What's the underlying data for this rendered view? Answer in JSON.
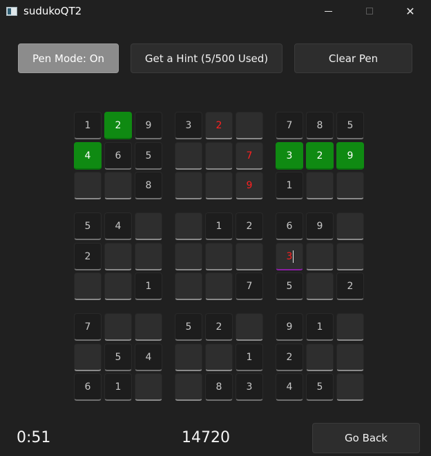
{
  "window": {
    "title": "sudukoQT2",
    "minimize_icon": "minimize-icon",
    "maximize_icon": "maximize-icon",
    "close_icon": "close-icon"
  },
  "toolbar": {
    "pen_mode_label": "Pen Mode: On",
    "hint_label": "Get a Hint (5/500 Used)",
    "clear_pen_label": "Clear Pen"
  },
  "board": {
    "rows": [
      [
        "1",
        "2",
        "9",
        "3",
        "2",
        "",
        "7",
        "8",
        "5"
      ],
      [
        "4",
        "6",
        "5",
        "",
        "",
        "7",
        "3",
        "2",
        "9"
      ],
      [
        "",
        "",
        "8",
        "",
        "",
        "9",
        "1",
        "",
        ""
      ],
      [
        "5",
        "4",
        "",
        "",
        "1",
        "2",
        "6",
        "9",
        ""
      ],
      [
        "2",
        "",
        "",
        "",
        "",
        "",
        "3",
        "",
        ""
      ],
      [
        "",
        "",
        "1",
        "",
        "",
        "7",
        "5",
        "",
        "2"
      ],
      [
        "7",
        "",
        "",
        "5",
        "2",
        "",
        "9",
        "1",
        ""
      ],
      [
        "",
        "5",
        "4",
        "",
        "",
        "1",
        "2",
        "",
        ""
      ],
      [
        "6",
        "1",
        "",
        "",
        "8",
        "3",
        "4",
        "5",
        ""
      ]
    ],
    "cell_styles": [
      [
        "given",
        "green",
        "given",
        "given",
        "red",
        "empty",
        "given",
        "given",
        "given"
      ],
      [
        "green",
        "given",
        "given",
        "empty",
        "empty",
        "red",
        "green",
        "green",
        "green"
      ],
      [
        "empty",
        "empty",
        "given",
        "empty",
        "empty",
        "red",
        "given",
        "empty",
        "empty"
      ],
      [
        "given",
        "given",
        "empty",
        "empty",
        "given",
        "given",
        "given",
        "given",
        "empty"
      ],
      [
        "given",
        "empty",
        "empty",
        "empty",
        "empty",
        "empty",
        "selected-red",
        "empty",
        "empty"
      ],
      [
        "empty",
        "empty",
        "given",
        "empty",
        "empty",
        "given",
        "given",
        "empty",
        "given"
      ],
      [
        "given",
        "empty",
        "empty",
        "given",
        "given",
        "empty",
        "given",
        "given",
        "empty"
      ],
      [
        "empty",
        "given",
        "given",
        "empty",
        "empty",
        "given",
        "given",
        "empty",
        "empty"
      ],
      [
        "given",
        "given",
        "empty",
        "empty",
        "given",
        "given",
        "given",
        "given",
        "empty"
      ]
    ],
    "colors": {
      "green": "#0f8a12",
      "red_text": "#ff2020",
      "selected_underline": "#8a1fa3"
    }
  },
  "footer": {
    "timer": "0:51",
    "score": "14720",
    "back_label": "Go Back"
  }
}
